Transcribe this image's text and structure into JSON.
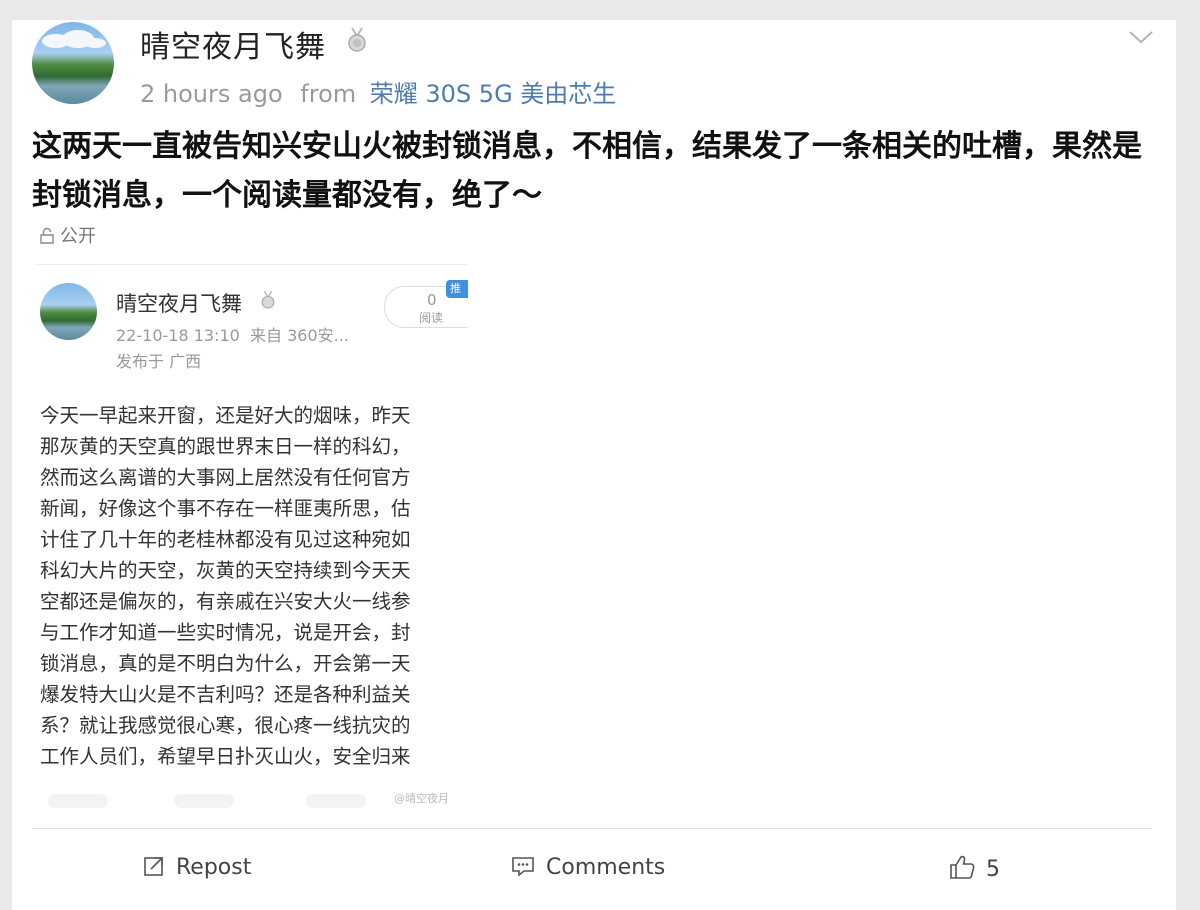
{
  "post": {
    "username": "晴空夜月飞舞",
    "time": "2 hours ago",
    "from_label": "from",
    "device": "荣耀 30S 5G 美由芯生",
    "text": "这两天一直被告知兴安山火被封锁消息，不相信，结果发了一条相关的吐槽，果然是封锁消息，一个阅读量都没有，绝了～",
    "visibility": "公开"
  },
  "screenshot": {
    "username": "晴空夜月飞舞",
    "date": "22-10-18 13:10",
    "source": "来自 360安...",
    "location": "发布于 广西",
    "read_count": "0",
    "read_label": "阅读",
    "tag": "推",
    "body_lines": [
      "今天一早起来开窗，还是好大的烟味，昨天",
      "那灰黄的天空真的跟世界末日一样的科幻，",
      "然而这么离谱的大事网上居然没有任何官方",
      "新闻，好像这个事不存在一样匪夷所思，估",
      "计住了几十年的老桂林都没有见过这种宛如",
      "科幻大片的天空，灰黄的天空持续到今天天",
      "空都还是偏灰的，有亲戚在兴安大火一线参",
      "与工作才知道一些实时情况，说是开会，封",
      "锁消息，真的是不明白为什么，开会第一天",
      "爆发特大山火是不吉利吗？还是各种利益关",
      "系？就让我感觉很心寒，很心疼一线抗灾的",
      "工作人员们，希望早日扑灭山火，安全归来"
    ],
    "watermark": "@晴空夜月"
  },
  "actions": {
    "repost_label": "Repost",
    "comments_label": "Comments",
    "likes_count": "5"
  },
  "icons": {
    "repost": "repost-icon",
    "comments": "comment-icon",
    "like": "thumbs-up-icon",
    "menu": "chevron-down-icon",
    "medal": "medal-icon",
    "visibility": "lock-icon"
  },
  "colors": {
    "device_link": "#4f7cae",
    "tag_blue": "#3d8fe0"
  }
}
